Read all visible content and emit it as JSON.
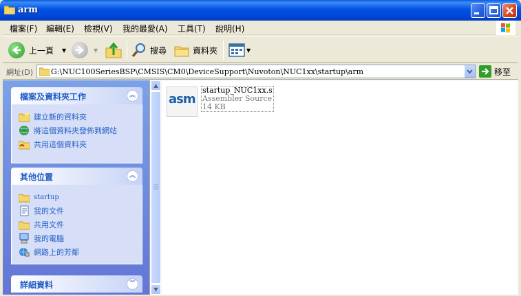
{
  "window": {
    "title": "arm",
    "colors": {
      "titlebar": "#0052e3",
      "taskpane": "#7ba2e7",
      "link": "#215dc6"
    }
  },
  "menu": {
    "items": [
      "檔案(F)",
      "編輯(E)",
      "檢視(V)",
      "我的最愛(A)",
      "工具(T)",
      "說明(H)"
    ]
  },
  "toolbar": {
    "back_label": "上一頁",
    "search_label": "搜尋",
    "folders_label": "資料夾"
  },
  "address": {
    "label": "網址(D)",
    "path": "G:\\NUC100SeriesBSP\\CMSIS\\CM0\\DeviceSupport\\Nuvoton\\NUC1xx\\startup\\arm",
    "go_label": "移至"
  },
  "tasks": {
    "file_folder": {
      "title": "檔案及資料夾工作",
      "links": [
        "建立新的資料夾",
        "將這個資料夾發佈到網站",
        "共用這個資料夾"
      ]
    },
    "other_places": {
      "title": "其他位置",
      "links": [
        "startup",
        "我的文件",
        "共用文件",
        "我的電腦",
        "網路上的芳鄰"
      ]
    },
    "details": {
      "title": "詳細資料"
    }
  },
  "files": [
    {
      "name": "startup_NUC1xx.s",
      "type": "Assembler Source",
      "size": "14 KB",
      "icon_text": "asm"
    }
  ]
}
